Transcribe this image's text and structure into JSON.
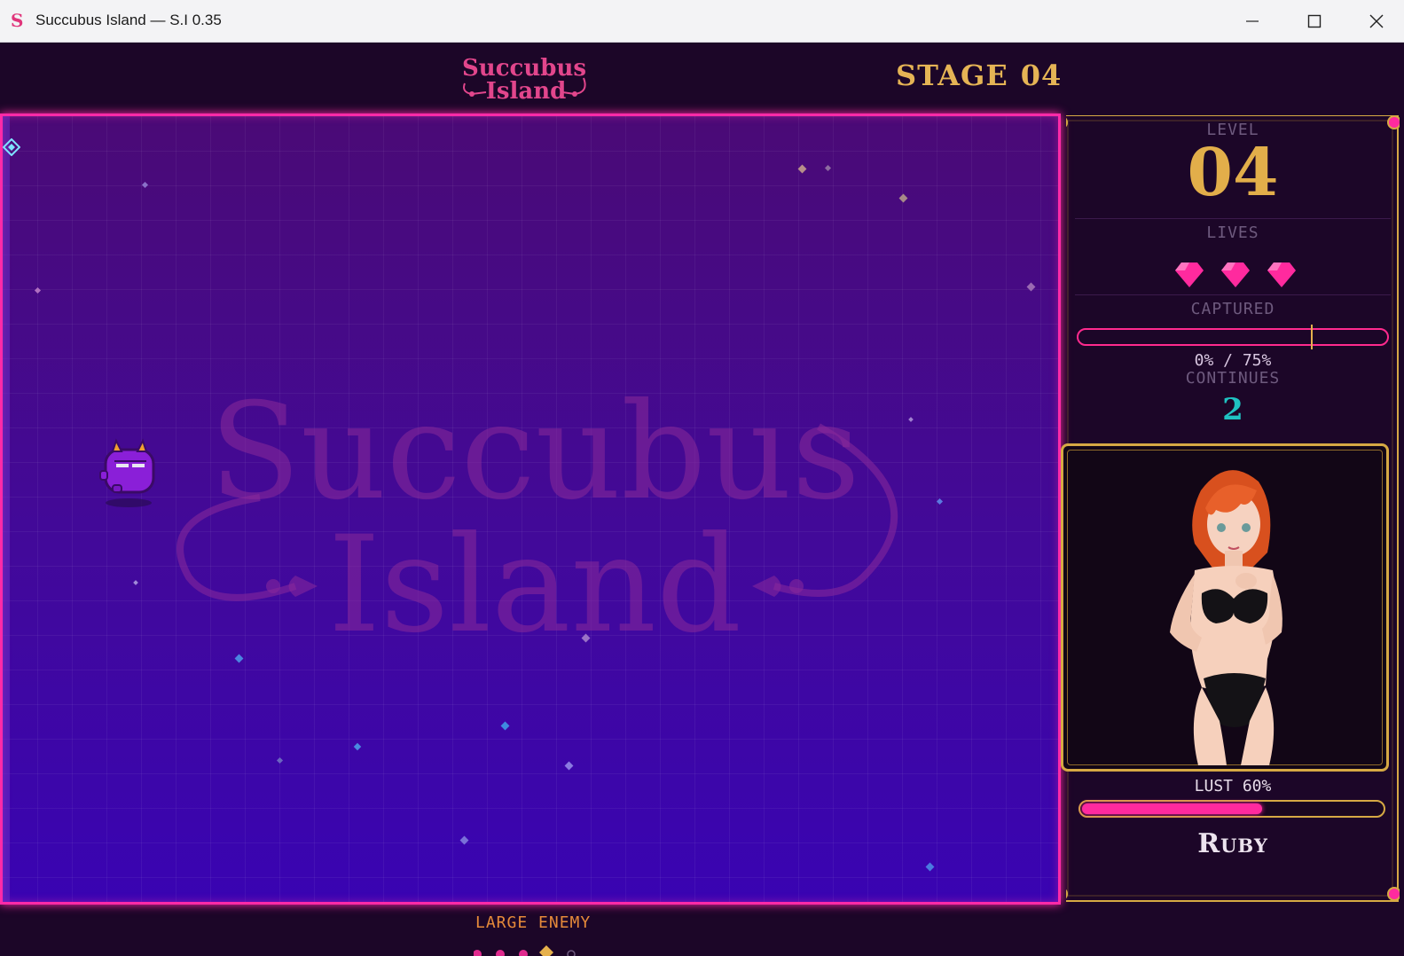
{
  "window": {
    "title": "Succubus Island  —  S.I 0.35",
    "icon": "succubus-s-logo-icon"
  },
  "header": {
    "logo_line1": "Succubus",
    "logo_line2": "Island",
    "stage_label": "STAGE",
    "stage_number": "04"
  },
  "playfield": {
    "watermark_line1": "Succubus",
    "watermark_line2": "Island"
  },
  "enemy_info": {
    "label": "LARGE ENEMY"
  },
  "stats": {
    "level_label": "LEVEL",
    "level_value": "04",
    "lives_label": "LIVES",
    "lives_count": 3,
    "captured_label": "CAPTURED",
    "captured_current": 0,
    "captured_target": 75,
    "captured_text": "0%  /  75%",
    "continues_label": "CONTINUES",
    "continues_value": "2"
  },
  "character": {
    "lust_label": "LUST 60%",
    "lust_percent": 60,
    "name": "Ruby"
  },
  "colors": {
    "accent_pink": "#ff2aa8",
    "gold": "#e2ae4a",
    "teal": "#1fc2c2",
    "playfield_bottom": "#3904b2"
  }
}
